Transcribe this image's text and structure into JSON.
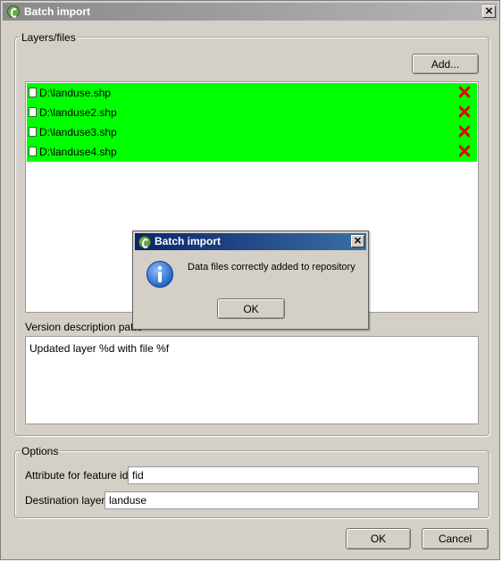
{
  "window": {
    "title": "Batch import",
    "close_glyph": "✕"
  },
  "layers_group": {
    "title": "Layers/files",
    "add_button": "Add...",
    "files": [
      {
        "path": "D:\\landuse.shp",
        "status_color": "#00ff00"
      },
      {
        "path": "D:\\landuse2.shp",
        "status_color": "#00ff00"
      },
      {
        "path": "D:\\landuse3.shp",
        "status_color": "#00ff00"
      },
      {
        "path": "D:\\landuse4.shp",
        "status_color": "#00ff00"
      }
    ]
  },
  "version_description": {
    "label": "Version description patte",
    "value": "Updated layer %d with file %f"
  },
  "options_group": {
    "title": "Options",
    "feature_id_label": "Attribute for feature id",
    "feature_id_value": "fid",
    "destination_label": "Destination layer:",
    "destination_value": "landuse"
  },
  "footer": {
    "ok_label": "OK",
    "cancel_label": "Cancel"
  },
  "dialog": {
    "title": "Batch import",
    "message": "Data files correctly added to repository",
    "ok_label": "OK",
    "close_glyph": "✕"
  },
  "icons": {
    "app": "qgis-icon",
    "remove": "red-x-icon",
    "file": "file-icon",
    "info": "info-icon"
  },
  "colors": {
    "remove_icon": "#e00000",
    "info_icon": "#1f5fbf",
    "success_row": "#00ff00"
  }
}
